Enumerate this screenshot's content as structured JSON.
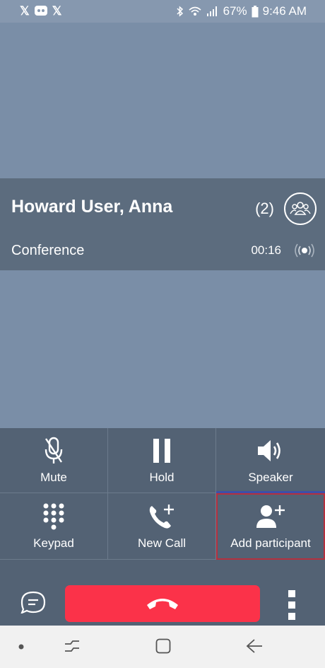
{
  "status_bar": {
    "battery": "67%",
    "time": "9:46 AM"
  },
  "call": {
    "name": "Howard User, Anna",
    "participant_count": "(2)",
    "type": "Conference",
    "timer": "00:16"
  },
  "controls": {
    "mute_label": "Mute",
    "hold_label": "Hold",
    "speaker_label": "Speaker",
    "keypad_label": "Keypad",
    "new_call_label": "New Call",
    "add_participant_label": "Add participant"
  },
  "colors": {
    "end_call": "#fb3249",
    "panel": "#536274",
    "selected_outline": "#b5303e"
  }
}
